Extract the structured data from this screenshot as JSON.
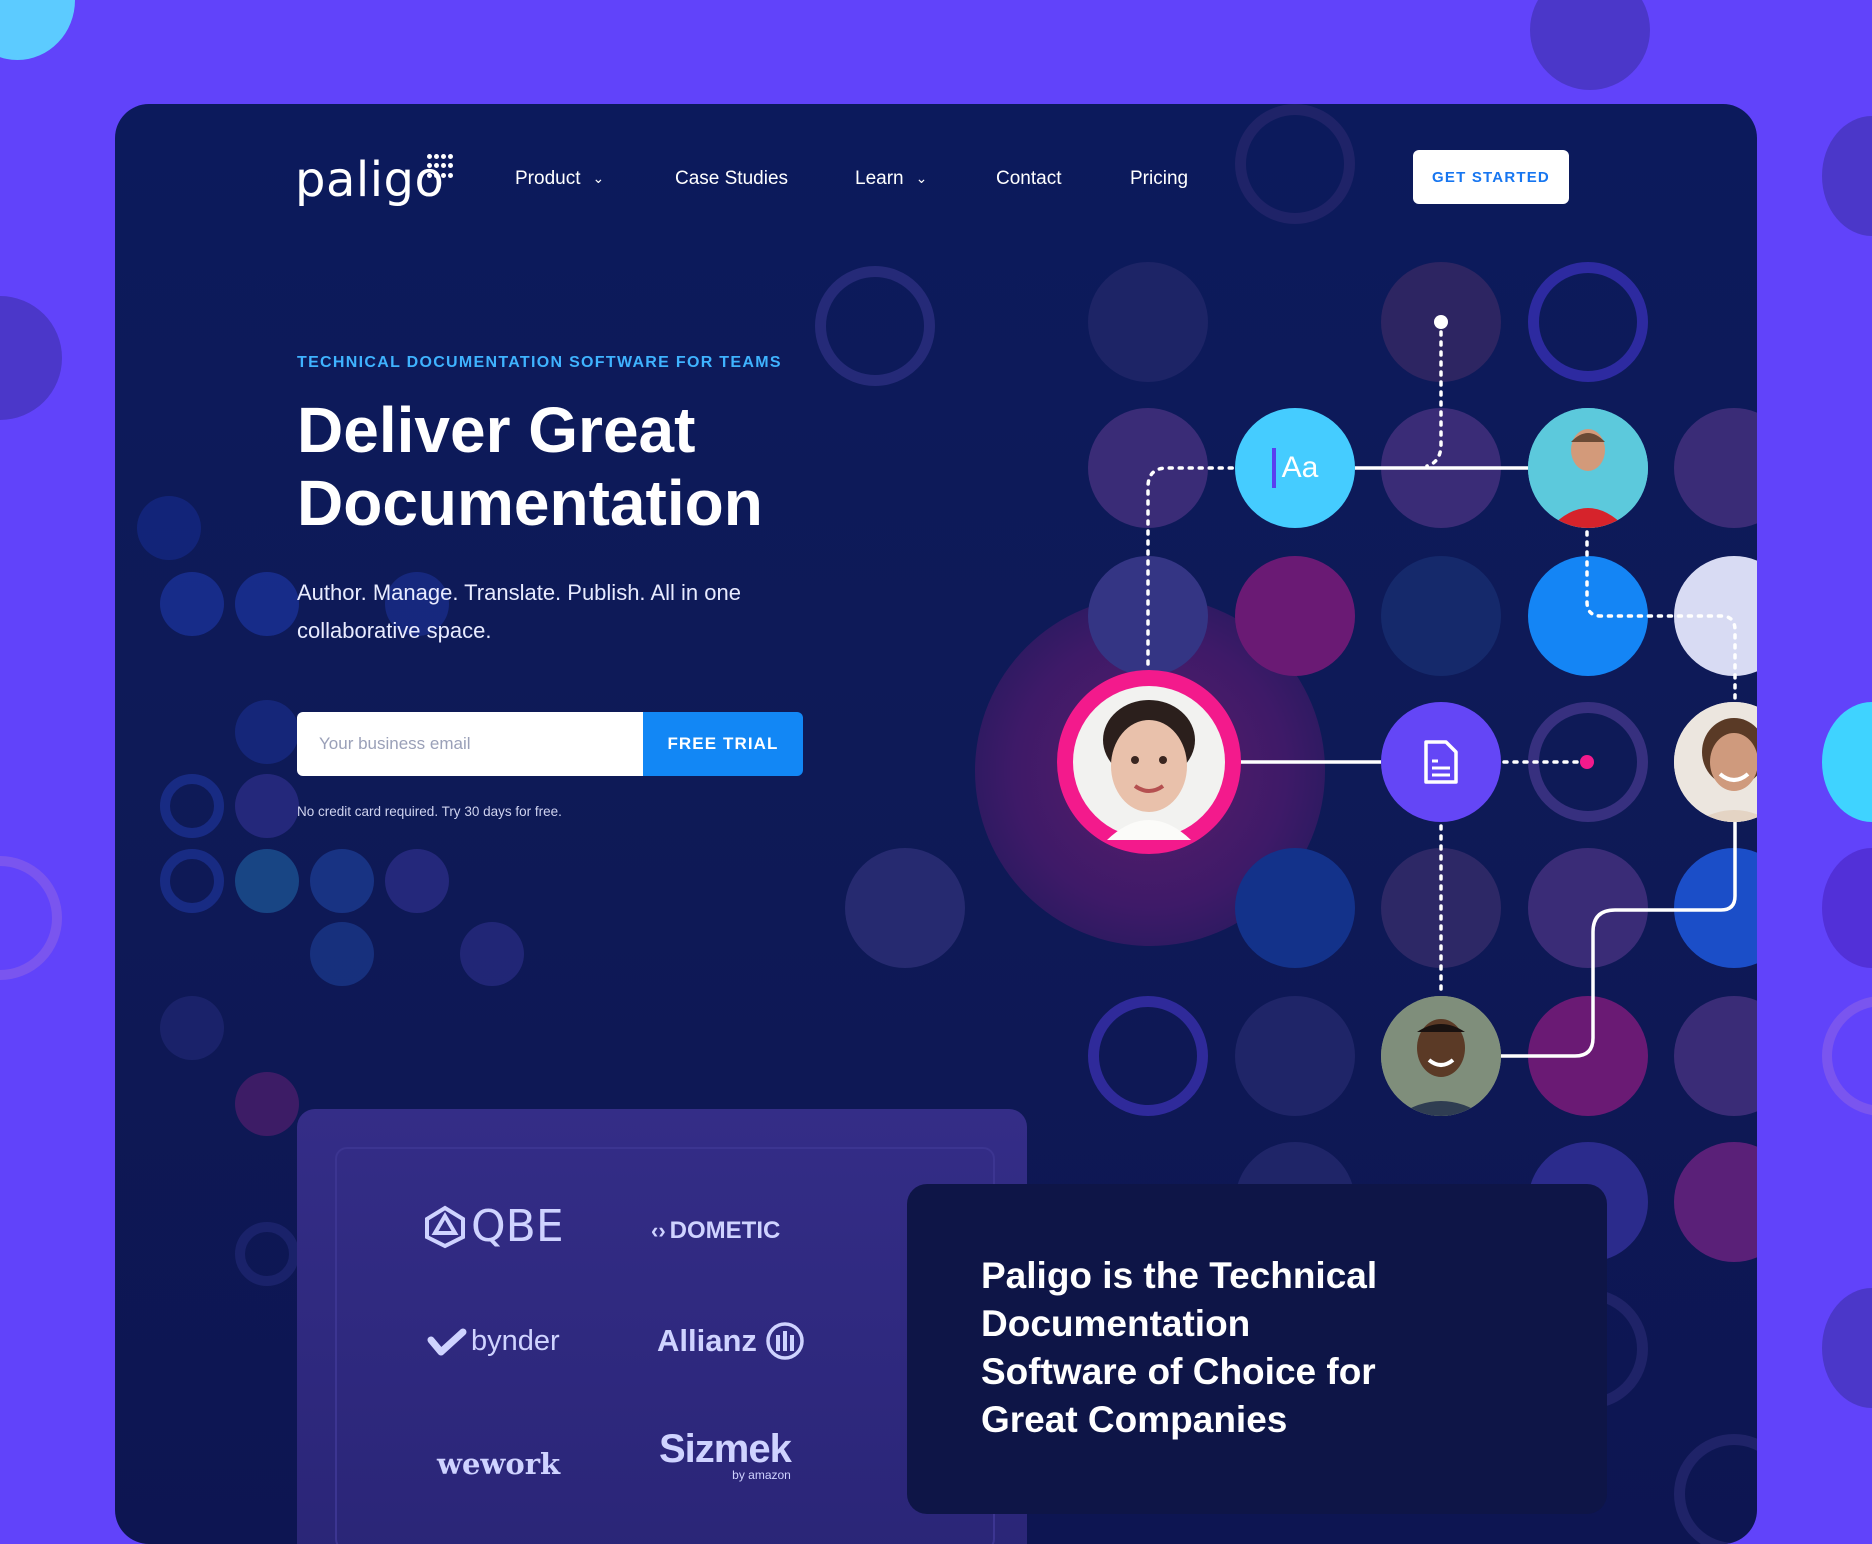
{
  "brand": {
    "name": "paligo"
  },
  "nav": {
    "items": [
      {
        "label": "Product",
        "has_dropdown": true
      },
      {
        "label": "Case Studies",
        "has_dropdown": false
      },
      {
        "label": "Learn",
        "has_dropdown": true
      },
      {
        "label": "Contact",
        "has_dropdown": false
      },
      {
        "label": "Pricing",
        "has_dropdown": false
      }
    ],
    "cta": "GET STARTED"
  },
  "hero": {
    "eyebrow": "TECHNICAL DOCUMENTATION SOFTWARE FOR TEAMS",
    "headline_line1": "Deliver Great",
    "headline_line2": "Documentation",
    "subheadline_line1": "Author. Manage. Translate. Publish. All in one",
    "subheadline_line2": "collaborative space.",
    "email_placeholder": "Your business email",
    "trial_button": "FREE TRIAL",
    "note": "No credit card required. Try 30 days for free."
  },
  "diagram": {
    "text_icon_label": "Aa",
    "icons": [
      "typography-icon",
      "document-icon"
    ]
  },
  "customers": {
    "logos": [
      "QBE",
      "DOMETIC",
      "bynder",
      "Allianz",
      "wework",
      "Sizmek"
    ],
    "sizmek_sub": "by amazon"
  },
  "pitch": {
    "line1": "Paligo is the Technical",
    "line2": "Documentation",
    "line3": "Software of Choice for",
    "line4": "Great Companies"
  },
  "colors": {
    "background": "#6143fa",
    "card": "#0c1a5c",
    "accent_blue": "#1287f5",
    "accent_cyan": "#3fd3ff",
    "accent_pink": "#f31a8c",
    "eyebrow": "#3fb3ff"
  }
}
